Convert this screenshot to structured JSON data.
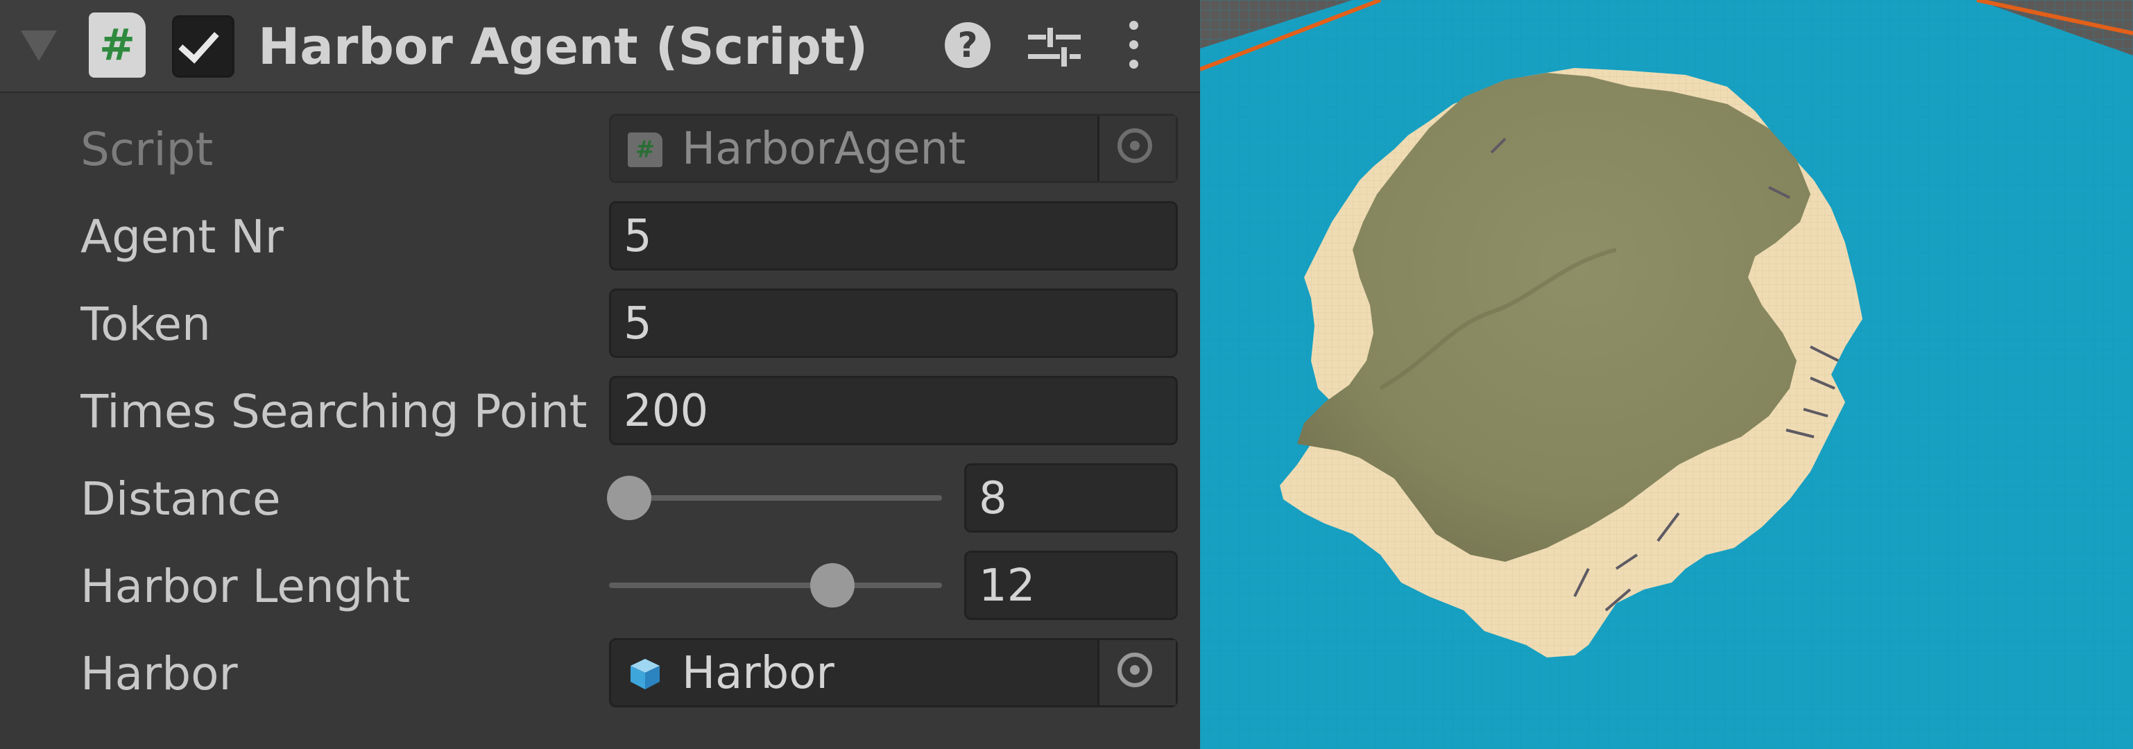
{
  "component": {
    "title": "Harbor Agent (Script)",
    "icons": {
      "foldout": "foldout-arrow-icon",
      "script": "csharp-script-icon",
      "help": "help-icon",
      "presets": "presets-sliders-icon",
      "menu": "kebab-menu-icon"
    },
    "script_icon_glyph": "#",
    "help_glyph": "?"
  },
  "properties": [
    {
      "label": "Script",
      "value": "HarborAgent",
      "kind": "object-readonly",
      "icon": "csharp-script-icon"
    },
    {
      "label": "Agent Nr",
      "value": "5",
      "kind": "int"
    },
    {
      "label": "Token",
      "value": "5",
      "kind": "int"
    },
    {
      "label": "Times Searching Point",
      "value": "200",
      "kind": "int"
    },
    {
      "label": "Distance",
      "value": "8",
      "kind": "slider",
      "slider_fraction": 0.06
    },
    {
      "label": "Harbor Lenght",
      "value": "12",
      "kind": "slider",
      "slider_fraction": 0.67
    },
    {
      "label": "Harbor",
      "value": "Harbor",
      "kind": "object",
      "icon": "prefab-cube-icon"
    }
  ],
  "scene": {
    "colors": {
      "water": "#18a0c2",
      "sand": "#efdcb4",
      "land": "#8b8b63",
      "ground_plane": "#5c5a58",
      "plane_edge": "#e2601a"
    }
  }
}
